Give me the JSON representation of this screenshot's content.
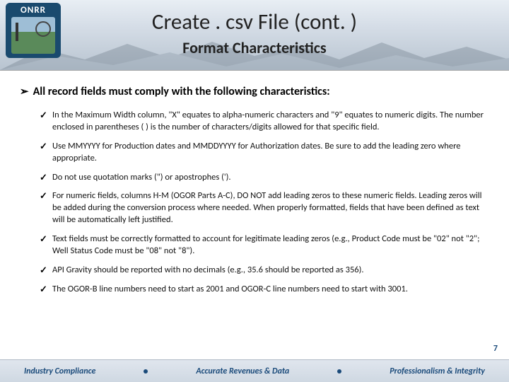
{
  "logo": {
    "acronym": "ONRR"
  },
  "header": {
    "title": "Create . csv File (cont. )",
    "subtitle": "Format Characteristics"
  },
  "lead": "All record fields must comply with the following characteristics:",
  "bullets": [
    "In the Maximum Width column, \"X\" equates to alpha-numeric characters and \"9\" equates to numeric digits. The number enclosed in parentheses ( ) is the number of characters/digits allowed for that specific field.",
    "Use MMYYYY for Production dates and MMDDYYYY for Authorization dates.  Be sure to add the leading zero where appropriate.",
    "Do not use quotation marks (\") or apostrophes (').",
    "For numeric fields, columns H-M (OGOR Parts A-C), DO NOT add leading zeros to these numeric fields. Leading zeros will be added during the conversion process where needed.  When properly formatted, fields that have been defined as text will be automatically left justified.",
    "Text fields must be correctly formatted to account for legitimate leading zeros (e.g., Product Code must be \"02\" not \"2\"; Well Status Code must be \"08\" not \"8\").",
    "API Gravity should be reported with no decimals (e.g., 35.6 should be reported as 356).",
    "The OGOR-B line numbers need to start as 2001 and OGOR-C line numbers need to start with 3001."
  ],
  "page_number": "7",
  "footer": {
    "left": "Industry Compliance",
    "center": "Accurate Revenues & Data",
    "right": "Professionalism & Integrity"
  }
}
